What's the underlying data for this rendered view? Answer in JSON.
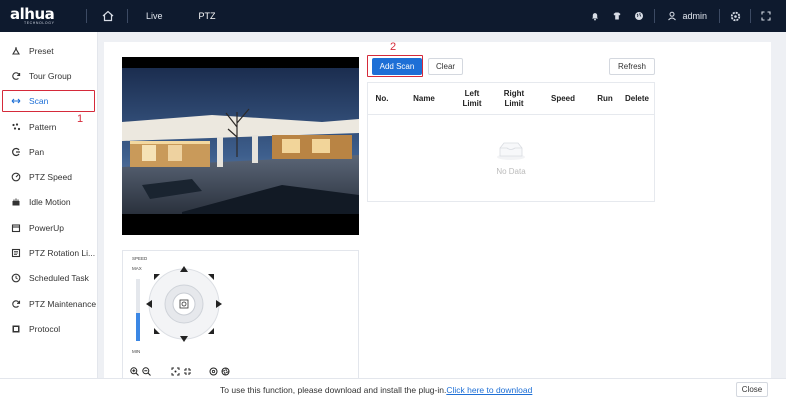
{
  "header": {
    "logo_text": "alhua",
    "logo_sub": "TECHNOLOGY",
    "nav": [
      {
        "label": "Live"
      },
      {
        "label": "PTZ"
      }
    ],
    "user": "admin"
  },
  "sidebar": {
    "items": [
      {
        "label": "Preset",
        "icon": "preset-icon"
      },
      {
        "label": "Tour Group",
        "icon": "tour-group-icon"
      },
      {
        "label": "Scan",
        "icon": "scan-icon"
      },
      {
        "label": "Pattern",
        "icon": "pattern-icon"
      },
      {
        "label": "Pan",
        "icon": "pan-icon"
      },
      {
        "label": "PTZ Speed",
        "icon": "ptz-speed-icon"
      },
      {
        "label": "Idle Motion",
        "icon": "idle-motion-icon"
      },
      {
        "label": "PowerUp",
        "icon": "powerup-icon"
      },
      {
        "label": "PTZ Rotation Li...",
        "icon": "rotation-limit-icon"
      },
      {
        "label": "Scheduled Task",
        "icon": "scheduled-task-icon"
      },
      {
        "label": "PTZ Maintenance",
        "icon": "maintenance-icon"
      },
      {
        "label": "Protocol",
        "icon": "protocol-icon"
      }
    ],
    "active_index": 2
  },
  "annotations": {
    "step1": "1",
    "step2": "2"
  },
  "toolbar": {
    "add_scan": "Add Scan",
    "clear": "Clear",
    "refresh": "Refresh"
  },
  "table": {
    "columns": [
      "No.",
      "Name",
      "Left Limit",
      "Right Limit",
      "Speed",
      "Run",
      "Delete"
    ],
    "rows": [],
    "empty_text": "No Data"
  },
  "ptz_panel": {
    "speed_label": "SPEED",
    "max_label": "MAX",
    "min_label": "MIN",
    "speed_level": 0.45
  },
  "bottom": {
    "message": "To use this function, please download and install the plug-in.",
    "link": "Click here to download",
    "close": "Close"
  },
  "colors": {
    "header_bg": "#0e1a2e",
    "accent": "#1d6fd6",
    "highlight": "#d52a3a"
  }
}
